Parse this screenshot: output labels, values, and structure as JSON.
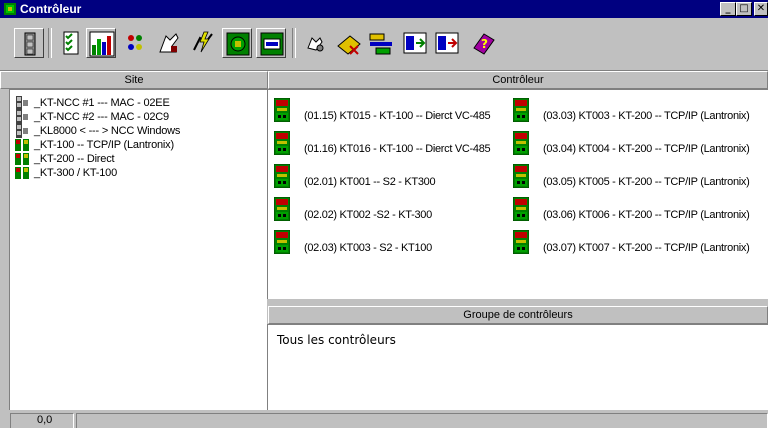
{
  "window": {
    "title": "Contrôleur"
  },
  "titlebar_buttons": {
    "minimize": "_",
    "maximize": "□",
    "close": "✕"
  },
  "toolbar": {
    "tools": [
      {
        "name": "door-panel-icon",
        "color": "#808080"
      },
      {
        "name": "checklist-icon",
        "color": "#008000"
      },
      {
        "name": "chart-report-icon",
        "color": "#008000"
      },
      {
        "name": "dots-icon",
        "color": "#c00000"
      },
      {
        "name": "hand-pointer-icon",
        "color": "#800000"
      },
      {
        "name": "lightning-icon",
        "color": "#c0c000"
      },
      {
        "name": "controller-board-icon",
        "color": "#008000"
      },
      {
        "name": "controller-card-icon",
        "color": "#008000"
      },
      {
        "name": "key-hand-icon",
        "color": "#606060"
      },
      {
        "name": "card-delete-icon",
        "color": "#c0a000"
      },
      {
        "name": "card-transfer-icon",
        "color": "#0000c0"
      },
      {
        "name": "screen-in-icon",
        "color": "#0000c0"
      },
      {
        "name": "screen-out-icon",
        "color": "#c00000"
      },
      {
        "name": "help-book-icon",
        "color": "#800080"
      }
    ]
  },
  "site": {
    "header": "Site",
    "items": [
      {
        "label": "_KT-NCC #1 --- MAC - 02EE",
        "icon": "ncc-door-icon"
      },
      {
        "label": "_KT-NCC #2 --- MAC - 02C9",
        "icon": "ncc-door-icon"
      },
      {
        "label": "_KL8000 < --- > NCC Windows",
        "icon": "ncc-door-icon"
      },
      {
        "label": "_KT-100 -- TCP/IP (Lantronix)",
        "icon": "kt-controller-icon"
      },
      {
        "label": "_KT-200 -- Direct",
        "icon": "kt-controller-icon"
      },
      {
        "label": "_KT-300 / KT-100",
        "icon": "kt-controller-icon"
      }
    ]
  },
  "controleur": {
    "header": "Contrôleur",
    "items": [
      {
        "label": "(01.15) KT015 - KT-100 -- Dierct VC-485"
      },
      {
        "label": "(01.16) KT016 - KT-100 -- Dierct VC-485"
      },
      {
        "label": "(02.01) KT001 -- S2 - KT300"
      },
      {
        "label": "(02.02) KT002 -S2  -  KT-300"
      },
      {
        "label": "(02.03) KT003 - S2 - KT100"
      },
      {
        "label": "(03.03) KT003 - KT-200 -- TCP/IP (Lantronix)"
      },
      {
        "label": "(03.04) KT004 - KT-200 -- TCP/IP (Lantronix)"
      },
      {
        "label": "(03.05) KT005 - KT-200 -- TCP/IP (Lantronix)"
      },
      {
        "label": "(03.06) KT006 - KT-200 -- TCP/IP (Lantronix)"
      },
      {
        "label": "(03.07) KT007 - KT-200 -- TCP/IP (Lantronix)"
      }
    ]
  },
  "groupe": {
    "header": "Groupe de contrôleurs",
    "text": "Tous les contrôleurs"
  },
  "status": {
    "coords": "0,0"
  },
  "colors": {
    "titlebar": "#000080",
    "face": "#c0c0c0",
    "panel": "#ffffff"
  }
}
